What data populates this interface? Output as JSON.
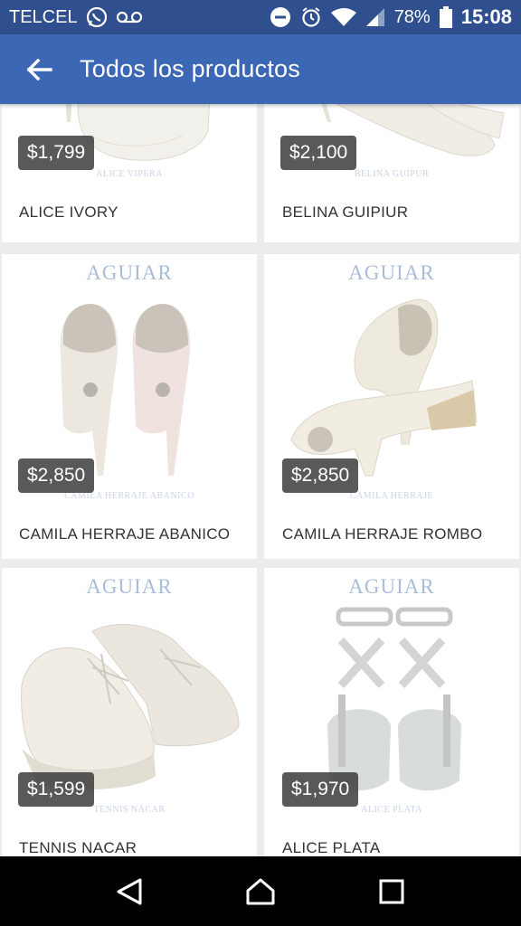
{
  "status_bar": {
    "carrier": "TELCEL",
    "battery": "78%",
    "time": "15:08"
  },
  "header": {
    "title": "Todos los productos"
  },
  "products": [
    {
      "name": "ALICE IVORY",
      "price": "$1,799",
      "caption": "ALICE VIPERA"
    },
    {
      "name": "BELINA GUIPIUR",
      "price": "$2,100",
      "caption": "BELINA GUIPUR"
    },
    {
      "name": "CAMILA HERRAJE ABANICO",
      "price": "$2,850",
      "caption": "CAMILA HERRAJE ABANICO",
      "brand": "AGUIAR"
    },
    {
      "name": "CAMILA HERRAJE ROMBO",
      "price": "$2,850",
      "caption": "CAMILA HERRAJE",
      "brand": "AGUIAR"
    },
    {
      "name": "TENNIS NACAR",
      "price": "$1,599",
      "caption": "TENNIS NÁCAR",
      "brand": "AGUIAR"
    },
    {
      "name": "ALICE PLATA",
      "price": "$1,970",
      "caption": "ALICE PLATA",
      "brand": "AGUIAR"
    }
  ],
  "icons": {
    "whatsapp": "whatsapp-icon",
    "voicemail": "voicemail-icon",
    "dnd": "do-not-disturb-icon",
    "alarm": "alarm-icon",
    "wifi": "wifi-icon",
    "signal": "signal-icon",
    "battery": "battery-icon",
    "back": "arrow-back-icon",
    "nav_back": "nav-back-icon",
    "nav_home": "nav-home-icon",
    "nav_recents": "nav-recents-icon"
  },
  "colors": {
    "app_bar": "#3c67b5",
    "status_bar": "#2f4f8f",
    "price_badge": "#3c3c3c"
  }
}
